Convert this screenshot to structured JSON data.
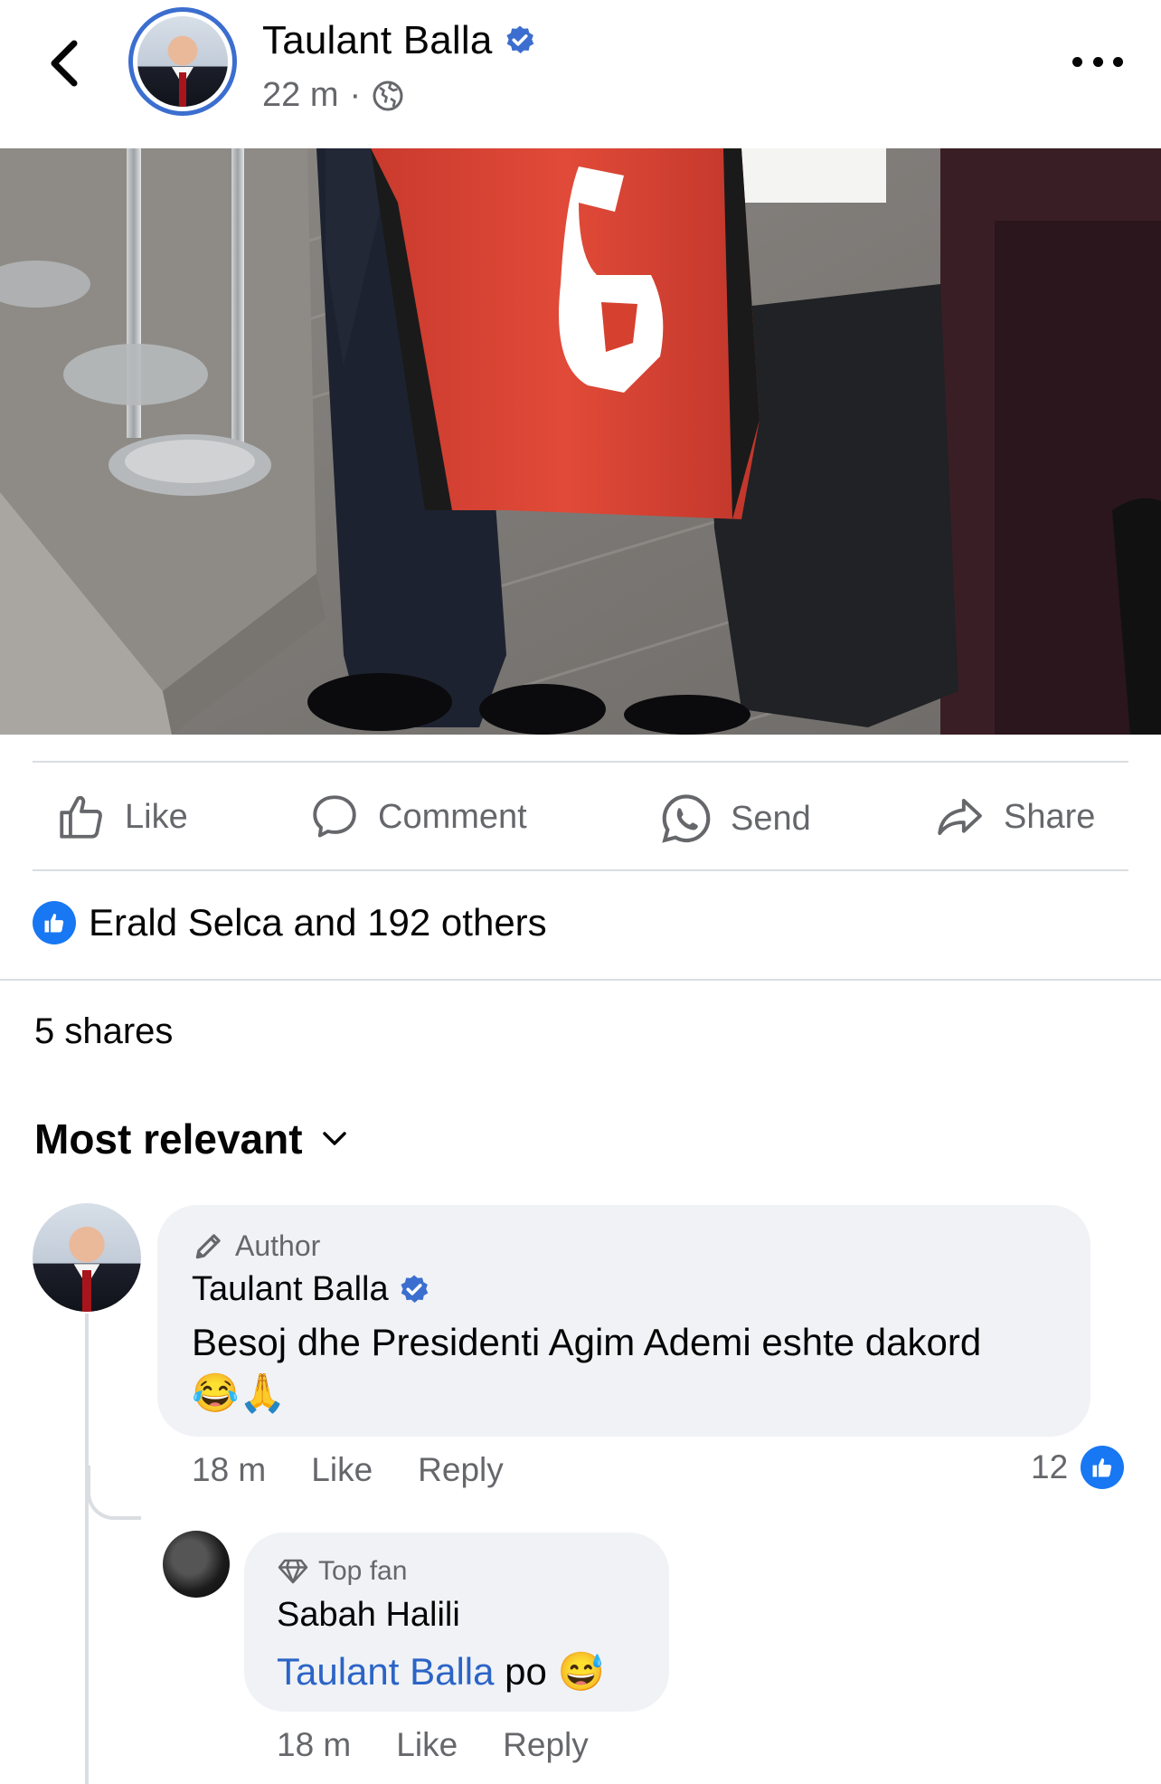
{
  "header": {
    "back_icon": "chevron-left-icon",
    "poster_name": "Taulant Balla",
    "post_time": "22 m",
    "separator": "·",
    "privacy_icon": "globe-icon",
    "more_icon": "more-horizontal-icon"
  },
  "actions": {
    "like": "Like",
    "comment": "Comment",
    "send": "Send",
    "share": "Share"
  },
  "reactions": {
    "text": "Erald Selca and 192 others",
    "icon": "like-badge-icon"
  },
  "shares_text": "5 shares",
  "sort_label": "Most relevant",
  "comments": [
    {
      "badge": "Author",
      "name": "Taulant Balla",
      "verified": true,
      "text": "Besoj dhe Presidenti Agim Ademi eshte dakord",
      "emojis": "😂🙏",
      "time": "18 m",
      "like_label": "Like",
      "reply_label": "Reply",
      "reaction_count": "12"
    }
  ],
  "reply": {
    "badge": "Top fan",
    "name": "Sabah Halili",
    "mention": "Taulant Balla",
    "text": " po ",
    "emoji": "😅",
    "time": "18 m",
    "like_label": "Like",
    "reply_label": "Reply"
  },
  "colors": {
    "accent": "#1877f2",
    "verified": "#3b6ecf",
    "muted": "#65676b",
    "bubble": "#f0f2f5",
    "mention": "#2c64c6"
  }
}
